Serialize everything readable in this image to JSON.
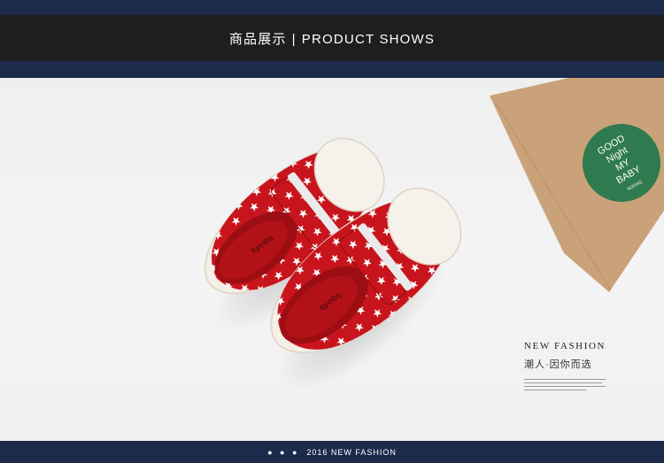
{
  "header": {
    "title_cn": "商品展示",
    "separator": "|",
    "title_en": "PRODUCT SHOWS"
  },
  "photo": {
    "sticker_lines": [
      "GOOD",
      "Night",
      "MY",
      "BABY"
    ],
    "sticker_small": "NODAQ",
    "insole_brand": "fqnnbq"
  },
  "caption": {
    "title": "NEW FASHION",
    "subtitle": "潮人·因你而选"
  },
  "footer": {
    "dots": "● ● ●",
    "text": "2016 NEW FASHION"
  },
  "colors": {
    "navy": "#1c2a4c",
    "dark_band": "#1e1e1e",
    "shoe_red": "#c8141c",
    "kraft": "#c9a27a",
    "sticker_green": "#2f7a4e"
  }
}
